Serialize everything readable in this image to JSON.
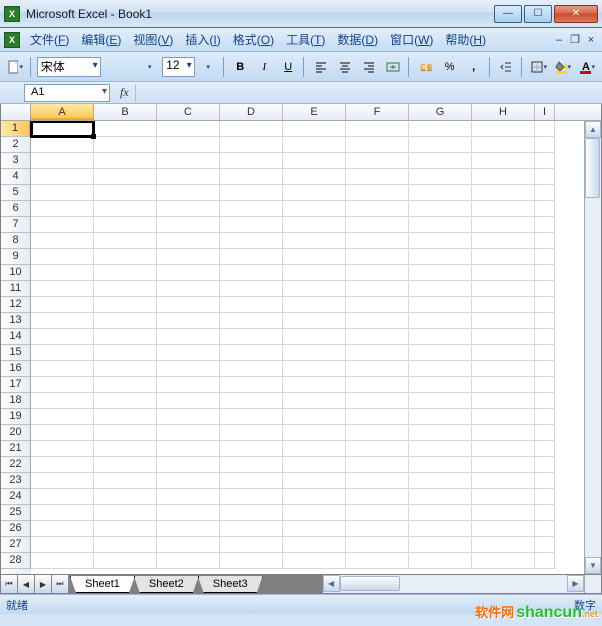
{
  "title": "Microsoft Excel - Book1",
  "menus": [
    "文件(F)",
    "编辑(E)",
    "视图(V)",
    "插入(I)",
    "格式(O)",
    "工具(T)",
    "数据(D)",
    "窗口(W)",
    "帮助(H)"
  ],
  "toolbar": {
    "font_name": "宋体",
    "font_size": "12",
    "bold": "B",
    "italic": "I",
    "underline": "U",
    "currency_symbol": "%",
    "currency_symbol2": ","
  },
  "nameBox": "A1",
  "fxLabel": "fx",
  "columns": [
    "A",
    "B",
    "C",
    "D",
    "E",
    "F",
    "G",
    "H",
    "I"
  ],
  "rowCount": 28,
  "activeCell": {
    "row": 1,
    "col": 0
  },
  "sheets": [
    "Sheet1",
    "Sheet2",
    "Sheet3"
  ],
  "activeSheet": 0,
  "status": {
    "left": "就绪",
    "right": "数字"
  },
  "watermark": {
    "cn": "软件网",
    "domain": "shancun",
    "tld": ".net"
  }
}
